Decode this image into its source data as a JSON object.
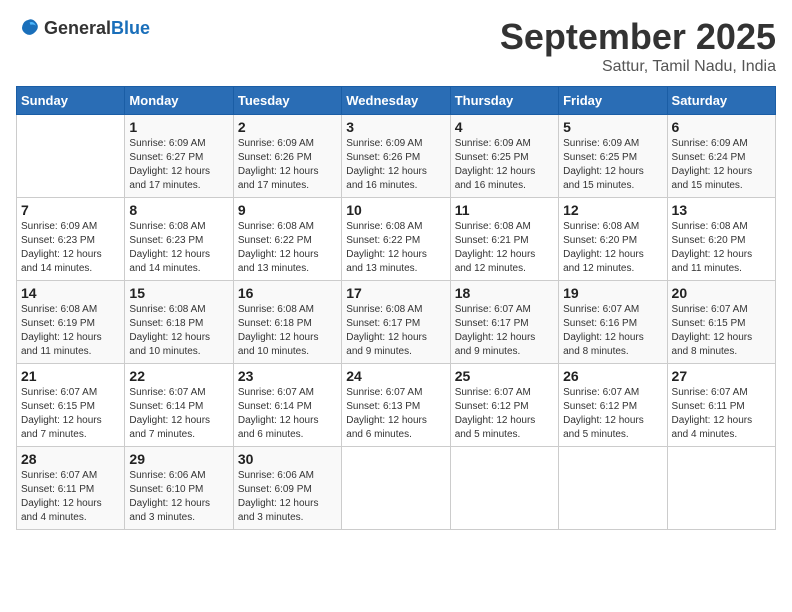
{
  "header": {
    "logo_general": "General",
    "logo_blue": "Blue",
    "month": "September 2025",
    "location": "Sattur, Tamil Nadu, India"
  },
  "days_of_week": [
    "Sunday",
    "Monday",
    "Tuesday",
    "Wednesday",
    "Thursday",
    "Friday",
    "Saturday"
  ],
  "weeks": [
    [
      {
        "day": "",
        "info": ""
      },
      {
        "day": "1",
        "info": "Sunrise: 6:09 AM\nSunset: 6:27 PM\nDaylight: 12 hours\nand 17 minutes."
      },
      {
        "day": "2",
        "info": "Sunrise: 6:09 AM\nSunset: 6:26 PM\nDaylight: 12 hours\nand 17 minutes."
      },
      {
        "day": "3",
        "info": "Sunrise: 6:09 AM\nSunset: 6:26 PM\nDaylight: 12 hours\nand 16 minutes."
      },
      {
        "day": "4",
        "info": "Sunrise: 6:09 AM\nSunset: 6:25 PM\nDaylight: 12 hours\nand 16 minutes."
      },
      {
        "day": "5",
        "info": "Sunrise: 6:09 AM\nSunset: 6:25 PM\nDaylight: 12 hours\nand 15 minutes."
      },
      {
        "day": "6",
        "info": "Sunrise: 6:09 AM\nSunset: 6:24 PM\nDaylight: 12 hours\nand 15 minutes."
      }
    ],
    [
      {
        "day": "7",
        "info": "Sunrise: 6:09 AM\nSunset: 6:23 PM\nDaylight: 12 hours\nand 14 minutes."
      },
      {
        "day": "8",
        "info": "Sunrise: 6:08 AM\nSunset: 6:23 PM\nDaylight: 12 hours\nand 14 minutes."
      },
      {
        "day": "9",
        "info": "Sunrise: 6:08 AM\nSunset: 6:22 PM\nDaylight: 12 hours\nand 13 minutes."
      },
      {
        "day": "10",
        "info": "Sunrise: 6:08 AM\nSunset: 6:22 PM\nDaylight: 12 hours\nand 13 minutes."
      },
      {
        "day": "11",
        "info": "Sunrise: 6:08 AM\nSunset: 6:21 PM\nDaylight: 12 hours\nand 12 minutes."
      },
      {
        "day": "12",
        "info": "Sunrise: 6:08 AM\nSunset: 6:20 PM\nDaylight: 12 hours\nand 12 minutes."
      },
      {
        "day": "13",
        "info": "Sunrise: 6:08 AM\nSunset: 6:20 PM\nDaylight: 12 hours\nand 11 minutes."
      }
    ],
    [
      {
        "day": "14",
        "info": "Sunrise: 6:08 AM\nSunset: 6:19 PM\nDaylight: 12 hours\nand 11 minutes."
      },
      {
        "day": "15",
        "info": "Sunrise: 6:08 AM\nSunset: 6:18 PM\nDaylight: 12 hours\nand 10 minutes."
      },
      {
        "day": "16",
        "info": "Sunrise: 6:08 AM\nSunset: 6:18 PM\nDaylight: 12 hours\nand 10 minutes."
      },
      {
        "day": "17",
        "info": "Sunrise: 6:08 AM\nSunset: 6:17 PM\nDaylight: 12 hours\nand 9 minutes."
      },
      {
        "day": "18",
        "info": "Sunrise: 6:07 AM\nSunset: 6:17 PM\nDaylight: 12 hours\nand 9 minutes."
      },
      {
        "day": "19",
        "info": "Sunrise: 6:07 AM\nSunset: 6:16 PM\nDaylight: 12 hours\nand 8 minutes."
      },
      {
        "day": "20",
        "info": "Sunrise: 6:07 AM\nSunset: 6:15 PM\nDaylight: 12 hours\nand 8 minutes."
      }
    ],
    [
      {
        "day": "21",
        "info": "Sunrise: 6:07 AM\nSunset: 6:15 PM\nDaylight: 12 hours\nand 7 minutes."
      },
      {
        "day": "22",
        "info": "Sunrise: 6:07 AM\nSunset: 6:14 PM\nDaylight: 12 hours\nand 7 minutes."
      },
      {
        "day": "23",
        "info": "Sunrise: 6:07 AM\nSunset: 6:14 PM\nDaylight: 12 hours\nand 6 minutes."
      },
      {
        "day": "24",
        "info": "Sunrise: 6:07 AM\nSunset: 6:13 PM\nDaylight: 12 hours\nand 6 minutes."
      },
      {
        "day": "25",
        "info": "Sunrise: 6:07 AM\nSunset: 6:12 PM\nDaylight: 12 hours\nand 5 minutes."
      },
      {
        "day": "26",
        "info": "Sunrise: 6:07 AM\nSunset: 6:12 PM\nDaylight: 12 hours\nand 5 minutes."
      },
      {
        "day": "27",
        "info": "Sunrise: 6:07 AM\nSunset: 6:11 PM\nDaylight: 12 hours\nand 4 minutes."
      }
    ],
    [
      {
        "day": "28",
        "info": "Sunrise: 6:07 AM\nSunset: 6:11 PM\nDaylight: 12 hours\nand 4 minutes."
      },
      {
        "day": "29",
        "info": "Sunrise: 6:06 AM\nSunset: 6:10 PM\nDaylight: 12 hours\nand 3 minutes."
      },
      {
        "day": "30",
        "info": "Sunrise: 6:06 AM\nSunset: 6:09 PM\nDaylight: 12 hours\nand 3 minutes."
      },
      {
        "day": "",
        "info": ""
      },
      {
        "day": "",
        "info": ""
      },
      {
        "day": "",
        "info": ""
      },
      {
        "day": "",
        "info": ""
      }
    ]
  ]
}
